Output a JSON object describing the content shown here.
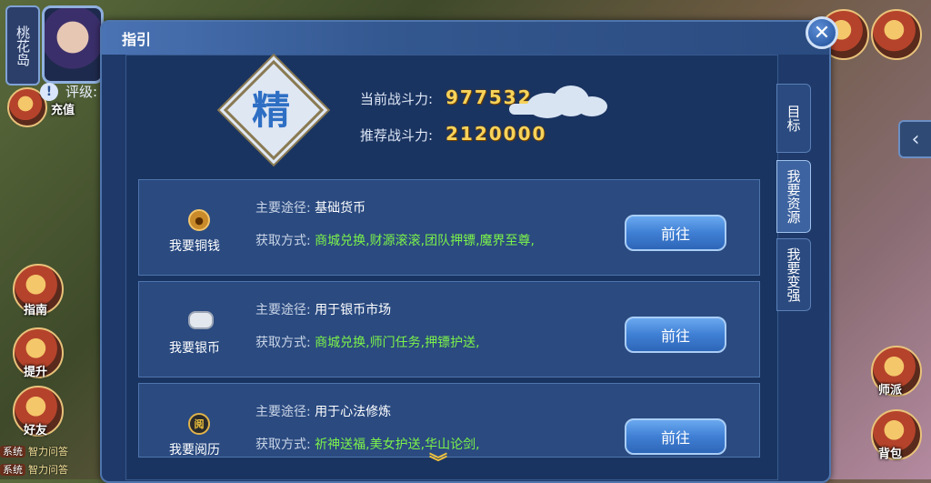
{
  "location": "桃花岛",
  "hud": {
    "recharge": "充值",
    "guide": "指南",
    "upgrade": "提升",
    "friends": "好友",
    "school": "师派",
    "bag": "背包"
  },
  "chat": [
    {
      "tag": "系统",
      "text": "智力问答"
    },
    {
      "tag": "系统",
      "text": "智力问答"
    }
  ],
  "dialog": {
    "title": "指引",
    "close_icon": "✕",
    "rating_label": "评级:",
    "grade": "精",
    "current_power_label": "当前战斗力:",
    "current_power_value": "977532",
    "recommended_power_label": "推荐战斗力:",
    "recommended_power_value": "2120000"
  },
  "tabs": [
    {
      "label": "目标",
      "active": false
    },
    {
      "label": "我要资源",
      "active": true
    },
    {
      "label": "我要变强",
      "active": false
    }
  ],
  "resources": [
    {
      "name": "我要铜钱",
      "icon": "copper-coin-icon",
      "purpose_label": "主要途径:",
      "purpose": "基础货币",
      "method_label": "获取方式:",
      "method": "商城兑换,财源滚滚,团队押镖,魔界至尊,",
      "button": "前往"
    },
    {
      "name": "我要银币",
      "icon": "silver-ingot-icon",
      "purpose_label": "主要途径:",
      "purpose": "用于银币市场",
      "method_label": "获取方式:",
      "method": "商城兑换,师门任务,押镖护送,",
      "button": "前往"
    },
    {
      "name": "我要阅历",
      "icon": "experience-badge-icon",
      "icon_char": "阅",
      "purpose_label": "主要途径:",
      "purpose": "用于心法修炼",
      "method_label": "获取方式:",
      "method": "祈神送福,美女护送,华山论剑,",
      "button": "前往"
    }
  ],
  "colors": {
    "accent_gold": "#f7d35a",
    "method_green": "#7cf24a",
    "panel_blue": "#1f3a6a"
  }
}
